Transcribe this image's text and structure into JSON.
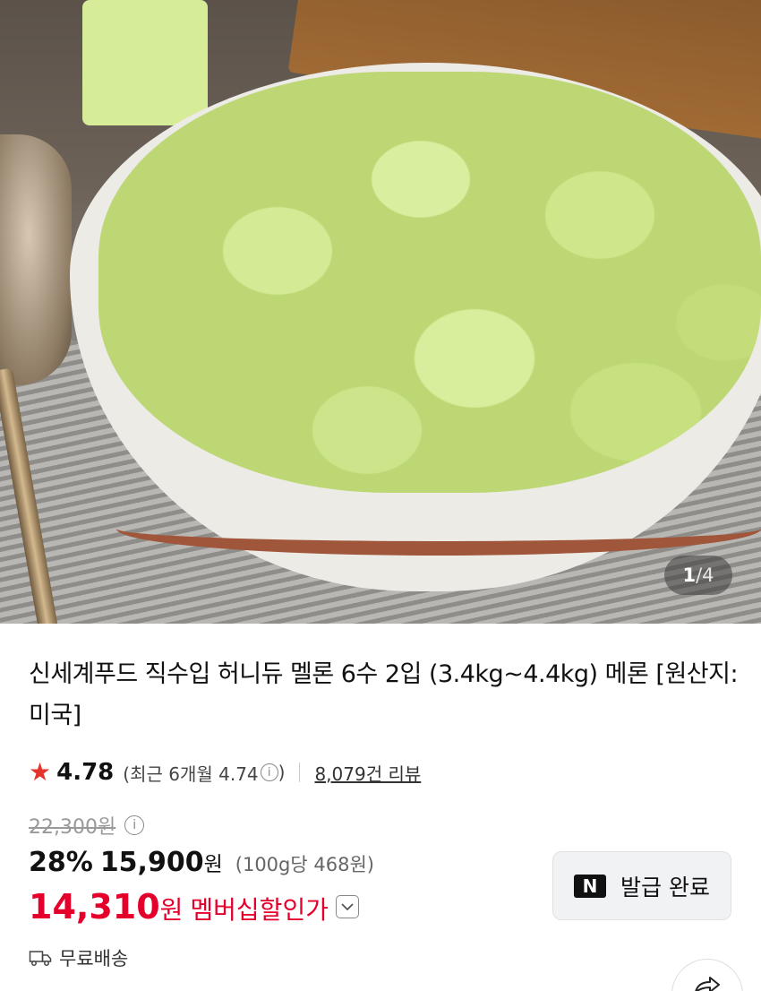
{
  "gallery": {
    "current_page": "1",
    "separator": "/",
    "total_pages": "4"
  },
  "product": {
    "title": "신세계푸드 직수입 허니듀 멜론 6수 2입 (3.4kg~4.4kg) 메론 [원산지:미국]"
  },
  "rating": {
    "star_icon": "★",
    "value": "4.78",
    "recent_text": "(최근 6개월 4.74",
    "recent_close": ")",
    "review_link": "8,079건 리뷰"
  },
  "pricing": {
    "original_price": "22,300원",
    "discount_rate": "28%",
    "sale_price": "15,900",
    "sale_unit": "원",
    "unit_price": "(100g당 468원)",
    "member_price": "14,310",
    "member_unit": "원",
    "member_label": "멤버십할인가",
    "accent_color": "#e4002b"
  },
  "coupon": {
    "icon_text": "N",
    "label": "발급 완료"
  },
  "shipping": {
    "label": "무료배송"
  },
  "icons": {
    "info": "i",
    "dropdown": "⌄"
  }
}
